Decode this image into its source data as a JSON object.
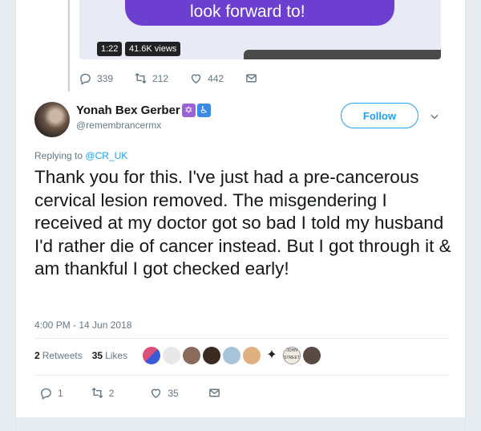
{
  "previous_tweet": {
    "video_caption": "look forward to!",
    "video_duration": "1:22",
    "video_views": "41.6K views",
    "actions": {
      "replies": "339",
      "retweets": "212",
      "likes": "442"
    }
  },
  "tweet": {
    "author_name": "Yonah Bex Gerber",
    "author_emojis": [
      "✡",
      "♿"
    ],
    "handle": "@remembrancermx",
    "follow_label": "Follow",
    "replying_prefix": "Replying to",
    "replying_to": "@CR_UK",
    "text": "Thank you for this. I've just had a pre-cancerous cervical lesion removed. The misgendering I received at my doctor got so bad I told my husband I'd rather die of cancer instead. But I got through it & am thankful I got checked early!",
    "timestamp": "4:00 PM - 14 Jun 2018",
    "retweets_count": "2",
    "retweets_label": "Retweets",
    "likes_count": "35",
    "likes_label": "Likes",
    "liker_avatar_colors": [
      "#d94f7a",
      "#c8c8c8",
      "#8a6a5a",
      "#3c2a22",
      "#a8c4d8",
      "#e0b080",
      "#222222",
      "#d8d0c0",
      "#5a4a44"
    ],
    "liker_avatar_last_text": "JOHN STREET",
    "actions": {
      "replies": "1",
      "retweets": "2",
      "likes": "35"
    }
  },
  "colors": {
    "accent": "#1da1f2",
    "muted": "#657786",
    "text": "#14171a"
  },
  "icons": [
    "reply-icon",
    "retweet-icon",
    "like-icon",
    "message-icon",
    "chevron-down-icon"
  ]
}
